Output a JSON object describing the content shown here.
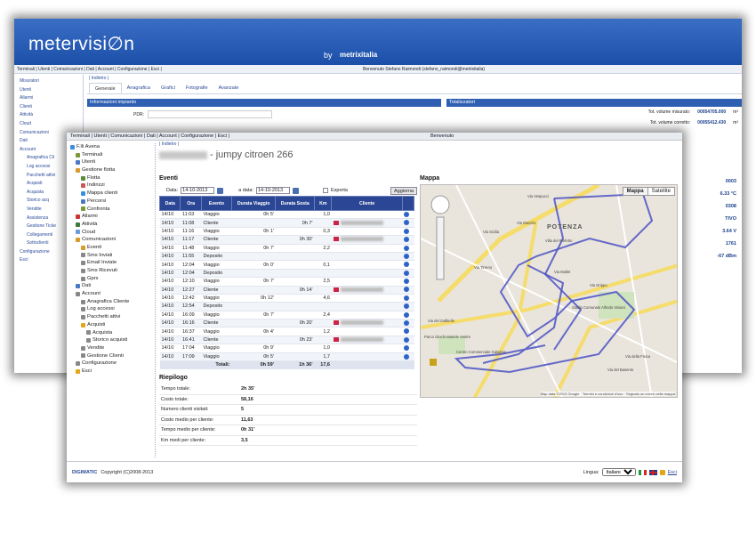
{
  "back_window": {
    "logo": "metervisi∅n",
    "by": "by",
    "brand": "metrixitalia",
    "menu": "Terminali | Utenti | Comunicazioni | Dati | Account | Configurazione | Esci |",
    "welcome": "Benvenuto Stefano Raimondi (stefano_raimondi@metrixitalia)",
    "sidebar": [
      "Misuratori",
      "Utenti",
      "Allarmi",
      "Clienti",
      "Attività",
      "Cloud",
      "Comunicazioni",
      "Dati",
      "Account",
      "Anagrafica Cli",
      "Log accessi",
      "Pacchetti attivi",
      "Acquisti",
      "Acquista",
      "Storico acq",
      "Vendite",
      "Assistenza",
      "Gestione Ticke",
      "Collegamenti",
      "Sottoclienti",
      "Configurazione",
      "Esci"
    ],
    "breadcrumb": "| Indietro |",
    "tabs": [
      "Generale",
      "Anagrafica",
      "Grafici",
      "Fotografie",
      "Avanzate"
    ],
    "section_info": "Informazioni impianto",
    "pdr_label": "PDR:",
    "section_totals": "Totalizzatori",
    "tot1_label": "Tot. volume misurato:",
    "tot1_value": "00054705.000",
    "tot1_unit": "m³",
    "tot2_label": "Tot. volume corretto:",
    "tot2_value": "00055412.430",
    "tot2_unit": "m³",
    "right_values": [
      "0003",
      "6.33",
      "0308",
      "TIVO",
      "3.64",
      "1761",
      "-67"
    ],
    "right_units": [
      "",
      "°C",
      "",
      "",
      "V",
      "",
      "dBm"
    ]
  },
  "menu": "Terminali | Utenti | Comunicazioni | Dati | Account | Configurazione | Esci |",
  "welcome": "Benvenuto",
  "tree": [
    {
      "label": "F.lli Avena",
      "icon": "globe-icon",
      "color": "#3a8de0",
      "indent": 0
    },
    {
      "label": "Terminali",
      "icon": "folder-icon",
      "color": "#7a9a3a",
      "indent": 1
    },
    {
      "label": "Utenti",
      "icon": "users-icon",
      "color": "#4a79c7",
      "indent": 1
    },
    {
      "label": "Gestione flotta",
      "icon": "folder-icon",
      "color": "#d89a2a",
      "indent": 1
    },
    {
      "label": "Flotta",
      "icon": "truck-icon",
      "color": "#5a8a3a",
      "indent": 2
    },
    {
      "label": "Indirizzi",
      "icon": "address-icon",
      "color": "#c55",
      "indent": 2
    },
    {
      "label": "Mappa clienti",
      "icon": "map-icon",
      "color": "#3a8de0",
      "indent": 2
    },
    {
      "label": "Percorsi",
      "icon": "route-icon",
      "color": "#4a79c7",
      "indent": 2
    },
    {
      "label": "Confronta",
      "icon": "compare-icon",
      "color": "#7a9a3a",
      "indent": 2
    },
    {
      "label": "Allarmi",
      "icon": "alarm-icon",
      "color": "#c33",
      "indent": 1
    },
    {
      "label": "Attività",
      "icon": "activity-icon",
      "color": "#3a7a3a",
      "indent": 1
    },
    {
      "label": "Cloud",
      "icon": "cloud-icon",
      "color": "#6a9ad8",
      "indent": 1
    },
    {
      "label": "Comunicazioni",
      "icon": "mail-icon",
      "color": "#d89a2a",
      "indent": 1
    },
    {
      "label": "Eventi",
      "icon": "event-icon",
      "color": "#d89a2a",
      "indent": 2
    },
    {
      "label": "Sms Inviati",
      "icon": "sms-icon",
      "color": "#888",
      "indent": 2
    },
    {
      "label": "Email Inviate",
      "icon": "email-icon",
      "color": "#888",
      "indent": 2
    },
    {
      "label": "Sms Ricevuti",
      "icon": "sms-icon",
      "color": "#888",
      "indent": 2
    },
    {
      "label": "Gprs",
      "icon": "gprs-icon",
      "color": "#888",
      "indent": 2
    },
    {
      "label": "Dati",
      "icon": "data-icon",
      "color": "#4a79c7",
      "indent": 1
    },
    {
      "label": "Account",
      "icon": "account-icon",
      "color": "#888",
      "indent": 1
    },
    {
      "label": "Anagrafica Cliente",
      "icon": "card-icon",
      "color": "#888",
      "indent": 2
    },
    {
      "label": "Log accessi",
      "icon": "log-icon",
      "color": "#888",
      "indent": 2
    },
    {
      "label": "Pacchetti attivi",
      "icon": "package-icon",
      "color": "#888",
      "indent": 2
    },
    {
      "label": "Acquisti",
      "icon": "cart-icon",
      "color": "#e5a519",
      "indent": 2
    },
    {
      "label": "Acquista",
      "icon": "buy-icon",
      "color": "#888",
      "indent": 3
    },
    {
      "label": "Storico acquisti",
      "icon": "history-icon",
      "color": "#888",
      "indent": 3
    },
    {
      "label": "Vendite",
      "icon": "sales-icon",
      "color": "#888",
      "indent": 2
    },
    {
      "label": "Gestione Clienti",
      "icon": "clients-icon",
      "color": "#888",
      "indent": 2
    },
    {
      "label": "Configurazione",
      "icon": "gear-icon",
      "color": "#888",
      "indent": 1
    },
    {
      "label": "Esci",
      "icon": "exit-icon",
      "color": "#e5a519",
      "indent": 1
    }
  ],
  "breadcrumb": "| Indietro |",
  "title": "- jumpy citroen 266",
  "events": {
    "heading": "Eventi",
    "from_label": "Data:",
    "from_value": "14-10-2013",
    "to_label": "a data:",
    "to_value": "14-10-2013",
    "export_label": "Esporta",
    "refresh_label": "Aggiorna",
    "columns": [
      "Data",
      "Ora",
      "Evento",
      "Durata Viaggio",
      "Durata Sosta",
      "Km",
      "Cliente",
      ""
    ],
    "rows": [
      [
        "14/10",
        "11:03",
        "Viaggio",
        "0h 5'",
        "",
        "1,0",
        false
      ],
      [
        "14/10",
        "11:08",
        "Cliente",
        "",
        "0h 7'",
        "",
        true
      ],
      [
        "14/10",
        "11:16",
        "Viaggio",
        "0h 1'",
        "",
        "0,3",
        false
      ],
      [
        "14/10",
        "11:17",
        "Cliente",
        "",
        "0h 30'",
        "",
        true
      ],
      [
        "14/10",
        "11:48",
        "Viaggio",
        "0h 7'",
        "",
        "2,2",
        false
      ],
      [
        "14/10",
        "11:55",
        "Deposito",
        "",
        "",
        "",
        false
      ],
      [
        "14/10",
        "12:04",
        "Viaggio",
        "0h 0'",
        "",
        "0,1",
        false
      ],
      [
        "14/10",
        "12:04",
        "Deposito",
        "",
        "",
        "",
        false
      ],
      [
        "14/10",
        "12:10",
        "Viaggio",
        "0h 7'",
        "",
        "2,5",
        false
      ],
      [
        "14/10",
        "12:27",
        "Cliente",
        "",
        "0h 14'",
        "",
        true
      ],
      [
        "14/10",
        "12:42",
        "Viaggio",
        "0h 12'",
        "",
        "4,6",
        false
      ],
      [
        "14/10",
        "12:54",
        "Deposito",
        "",
        "",
        "",
        false
      ],
      [
        "14/10",
        "16:09",
        "Viaggio",
        "0h 7'",
        "",
        "2,4",
        false
      ],
      [
        "14/10",
        "16:16",
        "Cliente",
        "",
        "0h 20'",
        "",
        true
      ],
      [
        "14/10",
        "16:37",
        "Viaggio",
        "0h 4'",
        "",
        "1,2",
        false
      ],
      [
        "14/10",
        "16:41",
        "Cliente",
        "",
        "0h 23'",
        "",
        true
      ],
      [
        "14/10",
        "17:04",
        "Viaggio",
        "0h 9'",
        "",
        "1,0",
        false
      ],
      [
        "14/10",
        "17:09",
        "Viaggio",
        "0h 5'",
        "",
        "1,7",
        false
      ]
    ],
    "totals_label": "Totali:",
    "totals": [
      "0h 59'",
      "1h 36'",
      "17,6"
    ]
  },
  "summary": {
    "heading": "Riepilogo",
    "rows": [
      [
        "Tempo totale:",
        "2h 35'"
      ],
      [
        "Costo totale:",
        "58,16"
      ],
      [
        "Numero clienti visitati:",
        "5"
      ],
      [
        "Costo medio per cliente:",
        "11,63"
      ],
      [
        "Tempo medio per cliente:",
        "0h 31'"
      ],
      [
        "Km medi per cliente:",
        "3,5"
      ]
    ]
  },
  "map": {
    "heading": "Mappa",
    "type_map": "Mappa",
    "type_sat": "Satellite",
    "city": "POTENZA",
    "attribution": "Map data ©2013 Google · Termini e condizioni d'uso · Segnala un errore nella mappa",
    "streets": [
      "Via del Gallitello",
      "Via Grippo",
      "Via Mazzini",
      "Via della Fisica",
      "Via Sicilia",
      "Via Vespucci",
      "Via Tirreno",
      "Via Mallet",
      "Parco Giochi Mariele Ventre",
      "Centro Commerciale Galassia",
      "Stadio Comunale Alfredo Viviani",
      "Villa del Prefetto",
      "Via del Basento"
    ]
  },
  "footer": {
    "company": "DIGIMATIC",
    "copyright": "Copyright (C)2008-2013",
    "lang_label": "Lingua:",
    "lang_value": "Italiano",
    "exit": "Esci"
  }
}
